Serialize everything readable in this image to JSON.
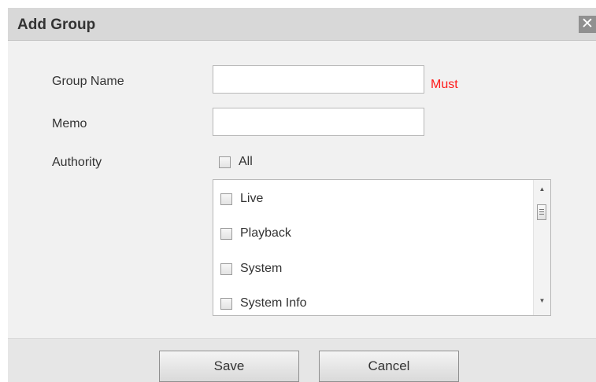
{
  "dialog": {
    "title": "Add Group",
    "close_symbol": "✕"
  },
  "form": {
    "group_name": {
      "label": "Group Name",
      "value": "",
      "placeholder": "",
      "hint": "Must"
    },
    "memo": {
      "label": "Memo",
      "value": "",
      "placeholder": ""
    },
    "authority": {
      "label": "Authority",
      "all_label": "All",
      "all_checked": false,
      "items": [
        {
          "label": "Live",
          "checked": false
        },
        {
          "label": "Playback",
          "checked": false
        },
        {
          "label": "System",
          "checked": false
        },
        {
          "label": "System Info",
          "checked": false
        }
      ]
    }
  },
  "buttons": {
    "save": "Save",
    "cancel": "Cancel"
  },
  "colors": {
    "must": "#ff1a1a",
    "titlebar": "#d8d8d8",
    "body": "#f1f1f1",
    "close_button": "#909090"
  },
  "icons": {
    "close": "close-icon",
    "scroll_up": "scroll-up-arrow-icon",
    "scroll_down": "scroll-down-arrow-icon",
    "checkbox": "checkbox-icon"
  }
}
